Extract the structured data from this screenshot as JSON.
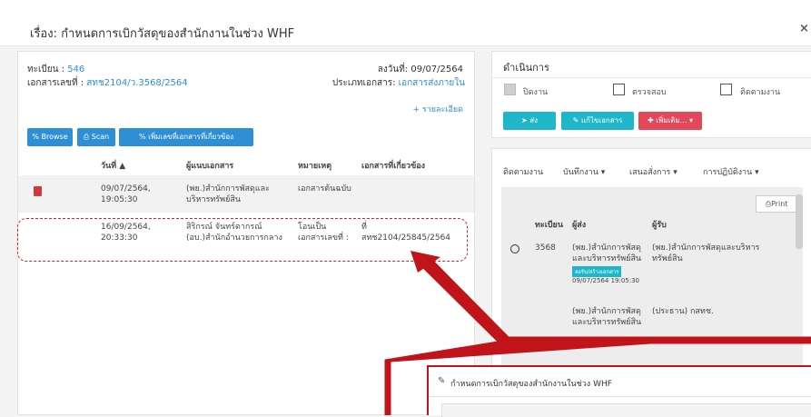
{
  "title": "เรื่อง: กำหนดการเบิกวัสดุของสำนักงานในช่วง WHF",
  "close_icon": "×",
  "doc": {
    "reg_label": "ทะเบียน :",
    "reg_value": "546",
    "docno_label": "เอกสารเลขที่ :",
    "docno_value": "สทช2104/ว.3568/2564",
    "date_text": "ลงวันที่: 09/07/2564",
    "type_label": "ประเภทเอกสาร:",
    "type_value": "เอกสารส่งภายใน",
    "detail_link": "+ รายละเอียด"
  },
  "buttons": {
    "browse": "Browse",
    "scan": "Scan",
    "add_related": "เพิ่มเลขที่เอกสารที่เกี่ยวข้อง"
  },
  "attach_table": {
    "headers": [
      "วันที่ ▲",
      "ผู้แนบเอกสาร",
      "หมายเหตุ",
      "เอกสารที่เกี่ยวข้อง"
    ],
    "rows": [
      {
        "date1": "09/07/2564,",
        "date2": "19:05:30",
        "by1": "(พย.)สำนักการพัสดุและ",
        "by2": "บริหารทรัพย์สิน",
        "note1": "เอกสารต้นฉบับ",
        "note2": "",
        "rel1": "",
        "rel2": ""
      },
      {
        "date1": "16/09/2564,",
        "date2": "20:33:30",
        "by1": "สิริกรณ์ จันทร์ดากรณ์",
        "by2": "(อบ.)สำนักอำนวยการกลาง",
        "note1": "โอนเป็น",
        "note2": "เอกสารเลขที่ :",
        "rel1": "ที่",
        "rel2": "สทช2104/25845/2564"
      }
    ]
  },
  "actions": {
    "heading": "ดำเนินการ",
    "chk_close": "ปิดงาน",
    "chk_review": "ตรวจสอบ",
    "chk_follow": "ติดตามงาน",
    "send": "ส่ง",
    "edit_doc": "แก้ไขเอกสาร",
    "more": "เพิ่มเติม... ▾"
  },
  "tracking": {
    "tabs": [
      "ติดตามงาน",
      "บันทึกงาน ▾",
      "เสนอสั่งการ ▾",
      "การปฏิบัติงาน ▾"
    ],
    "print": "Print",
    "headers": [
      "ทะเบียน",
      "ผู้ส่ง",
      "ผู้รับ"
    ],
    "rows": [
      {
        "reg": "3568",
        "from1": "(พย.)สำนักการพัสดุ",
        "from2": "และบริหารทรัพย์สิน",
        "badge": "ลงรับ/สร้างเอกสาร",
        "time": "09/07/2564 19:05:30",
        "to1": "(พย.)สำนักการพัสดุและบริหาร",
        "to2": "ทรัพย์สิน"
      },
      {
        "reg": "",
        "from1": "(พย.)สำนักการพัสดุ",
        "from2": "และบริหารทรัพย์สิน",
        "badge": "",
        "time": "",
        "to1": "(ประธาน) กสทช.",
        "to2": ""
      }
    ]
  },
  "popup": {
    "title": "กำหนดการเบิกวัสดุของสำนักงานในช่วง WHF"
  },
  "colors": {
    "accent": "#2e8fd6",
    "teal": "#1fb6c9",
    "danger": "#e2475a",
    "callout": "#c0141a"
  }
}
